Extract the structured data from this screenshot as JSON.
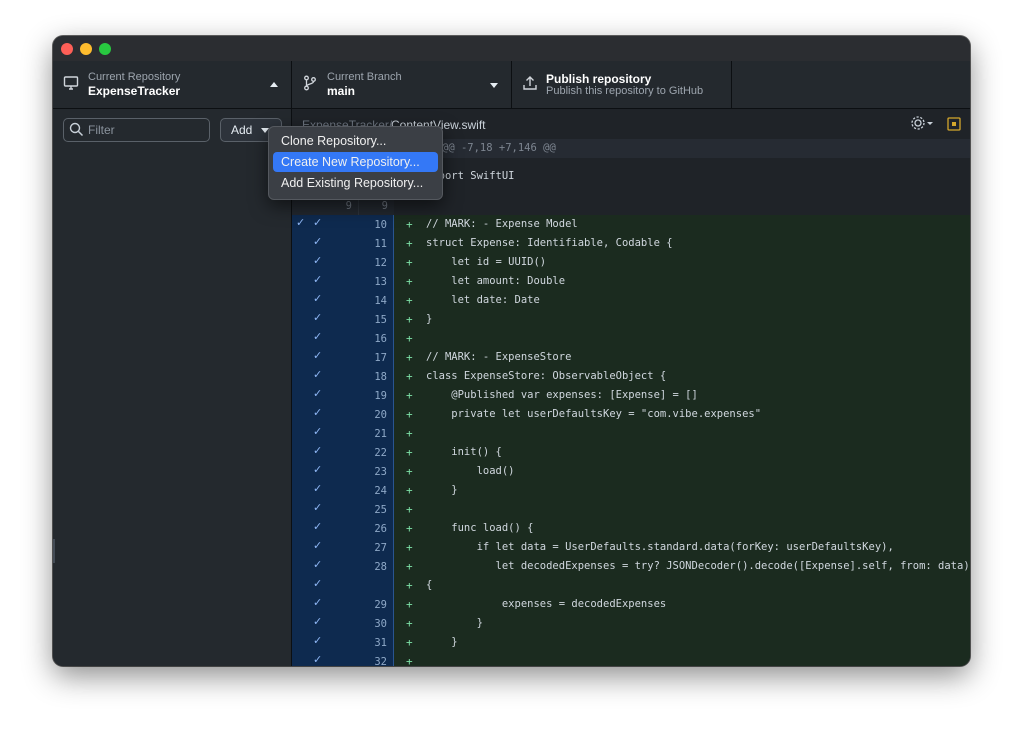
{
  "toolbar": {
    "repo": {
      "small": "Current Repository",
      "big": "ExpenseTracker"
    },
    "branch": {
      "small": "Current Branch",
      "big": "main"
    },
    "publish": {
      "big": "Publish repository",
      "small": "Publish this repository to GitHub"
    }
  },
  "sidebar": {
    "filter_placeholder": "Filter",
    "add_label": "Add"
  },
  "dropdown": {
    "items": [
      "Clone Repository...",
      "Create New Repository...",
      "Add Existing Repository..."
    ],
    "selected_index": 1
  },
  "diff": {
    "path_dir": "ExpenseTracker/",
    "path_file": "ContentView.swift",
    "hunk_header": "@@ -7,18 +7,146 @@",
    "context_lines": [
      {
        "old": "",
        "new": "",
        "text": "import SwiftUI"
      },
      {
        "old": "9",
        "new": "9",
        "text": ""
      }
    ],
    "added_lines": [
      {
        "n": "10",
        "text": "// MARK: - Expense Model"
      },
      {
        "n": "11",
        "text": "struct Expense: Identifiable, Codable {"
      },
      {
        "n": "12",
        "text": "    let id = UUID()"
      },
      {
        "n": "13",
        "text": "    let amount: Double"
      },
      {
        "n": "14",
        "text": "    let date: Date"
      },
      {
        "n": "15",
        "text": "}"
      },
      {
        "n": "16",
        "text": ""
      },
      {
        "n": "17",
        "text": "// MARK: - ExpenseStore"
      },
      {
        "n": "18",
        "text": "class ExpenseStore: ObservableObject {"
      },
      {
        "n": "19",
        "text": "    @Published var expenses: [Expense] = []"
      },
      {
        "n": "20",
        "text": "    private let userDefaultsKey = \"com.vibe.expenses\""
      },
      {
        "n": "21",
        "text": ""
      },
      {
        "n": "22",
        "text": "    init() {"
      },
      {
        "n": "23",
        "text": "        load()"
      },
      {
        "n": "24",
        "text": "    }"
      },
      {
        "n": "25",
        "text": ""
      },
      {
        "n": "26",
        "text": "    func load() {"
      },
      {
        "n": "27",
        "text": "        if let data = UserDefaults.standard.data(forKey: userDefaultsKey),"
      },
      {
        "n": "28",
        "text": "           let decodedExpenses = try? JSONDecoder().decode([Expense].self, from: data)"
      },
      {
        "n": "",
        "text": "{"
      },
      {
        "n": "29",
        "text": "            expenses = decodedExpenses"
      },
      {
        "n": "30",
        "text": "        }"
      },
      {
        "n": "31",
        "text": "    }"
      },
      {
        "n": "32",
        "text": ""
      }
    ]
  },
  "colors": {
    "window_bg": "#24292f",
    "added_bg": "#1b2b1f",
    "gutter_added_bg": "#0e2a4f",
    "selected_menu_item": "#3478f6",
    "plus_sign": "#7ee2a8"
  }
}
